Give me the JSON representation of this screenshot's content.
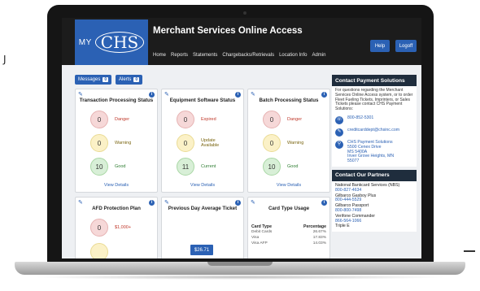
{
  "header": {
    "logo_my": "MY",
    "logo_chs": "CHS",
    "title": "Merchant Services Online Access",
    "nav": [
      "Home",
      "Reports",
      "Statements",
      "Chargebacks/Retrievals",
      "Location Info",
      "Admin"
    ],
    "help_label": "Help",
    "logoff_label": "Logoff"
  },
  "toolbar": {
    "messages_label": "Messages",
    "messages_count": "0",
    "alerts_label": "Alerts",
    "alerts_count": "0"
  },
  "cards": [
    {
      "title": "Transaction Processing Status",
      "stats": [
        {
          "value": "0",
          "label": "Danger"
        },
        {
          "value": "0",
          "label": "Warning"
        },
        {
          "value": "10",
          "label": "Good"
        }
      ],
      "link": "View Details"
    },
    {
      "title": "Equipment Software Status",
      "stats": [
        {
          "value": "0",
          "label": "Expired"
        },
        {
          "value": "0",
          "label": "Update Available"
        },
        {
          "value": "11",
          "label": "Current"
        }
      ],
      "link": "View Details"
    },
    {
      "title": "Batch Processing Status",
      "stats": [
        {
          "value": "0",
          "label": "Danger"
        },
        {
          "value": "0",
          "label": "Warning"
        },
        {
          "value": "10",
          "label": "Good"
        }
      ],
      "link": "View Details"
    }
  ],
  "afd": {
    "title": "AFD Protection Plan",
    "value": "0",
    "label": "$1,000+"
  },
  "avg_ticket": {
    "title": "Previous Day Average Ticket",
    "value": "$26.71"
  },
  "card_type": {
    "title": "Card Type Usage",
    "col1": "Card Type",
    "col2": "Percentage",
    "rows": [
      {
        "type": "Debit Cards",
        "pct": "26.67%"
      },
      {
        "type": "Visa",
        "pct": "17.83%"
      },
      {
        "type": "Visa AFP",
        "pct": "14.03%"
      }
    ]
  },
  "contact": {
    "title": "Contact Payment Solutions",
    "intro": "For questions regarding the Merchant Services Online Access system, or to order Fleet Fueling Tickets, Imprinters, or Sales Tickets please contact CHS Payment Solutions:",
    "phone": "800-852-5301",
    "email": "creditcarddept@chsinc.com",
    "address": [
      "CHS Payment Solutions",
      "5500 Cenex Drive",
      "MS 5400A",
      "Inver Grove Heights, MN",
      "55077"
    ]
  },
  "partners": {
    "title": "Contact Our Partners",
    "list": [
      {
        "name": "National Bankcard Services (NBS)",
        "phone": "800-827-4634"
      },
      {
        "name": "Gilbarco Gasboy Plus",
        "phone": "800-444-5529"
      },
      {
        "name": "Gilbarco Passport",
        "phone": "800-800-7498"
      },
      {
        "name": "Verifone Commander",
        "phone": "866-564-1066"
      },
      {
        "name": "Triple E",
        "phone": ""
      }
    ]
  },
  "colors": {
    "brand": "#2b61b4",
    "header_bg": "#1c1c1c",
    "panel_header": "#1f2d3d"
  }
}
